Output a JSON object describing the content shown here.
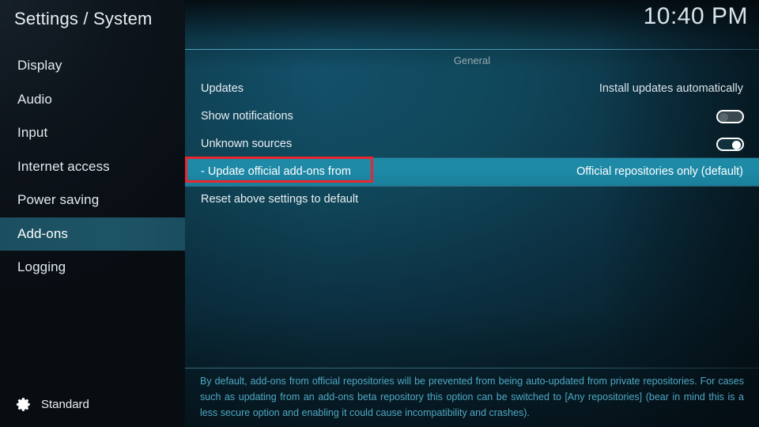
{
  "header": {
    "title": "Settings / System",
    "clock": "10:40 PM"
  },
  "sidebar": {
    "items": [
      {
        "label": "Display",
        "selected": false
      },
      {
        "label": "Audio",
        "selected": false
      },
      {
        "label": "Input",
        "selected": false
      },
      {
        "label": "Internet access",
        "selected": false
      },
      {
        "label": "Power saving",
        "selected": false
      },
      {
        "label": "Add-ons",
        "selected": true
      },
      {
        "label": "Logging",
        "selected": false
      }
    ],
    "profile": {
      "icon": "gear-icon",
      "label": "Standard"
    }
  },
  "main": {
    "group_header": "General",
    "rows": [
      {
        "label": "Updates",
        "type": "value",
        "value": "Install updates automatically",
        "selected": false
      },
      {
        "label": "Show notifications",
        "type": "toggle",
        "toggle_state": "off",
        "selected": false
      },
      {
        "label": "Unknown sources",
        "type": "toggle",
        "toggle_state": "on",
        "selected": false
      },
      {
        "label": "- Update official add-ons from",
        "type": "value",
        "value": "Official repositories only (default)",
        "selected": true
      },
      {
        "label": "Reset above settings to default",
        "type": "none",
        "value": "",
        "selected": false
      }
    ],
    "description": "By default, add-ons from official repositories will be prevented from being auto-updated from private repositories. For cases such as updating from an add-ons beta repository this option can be switched to [Any repositories] (bear in mind this is a less secure option and enabling it could cause incompatibility and crashes)."
  },
  "annotation": {
    "target": "- Update official add-ons from",
    "color": "#e8262c"
  },
  "colors": {
    "selected_row": "#1f8aa7",
    "selected_nav": "#1d5465",
    "description_text": "#4fa8c4",
    "accent_rule": "#56b2ce"
  }
}
